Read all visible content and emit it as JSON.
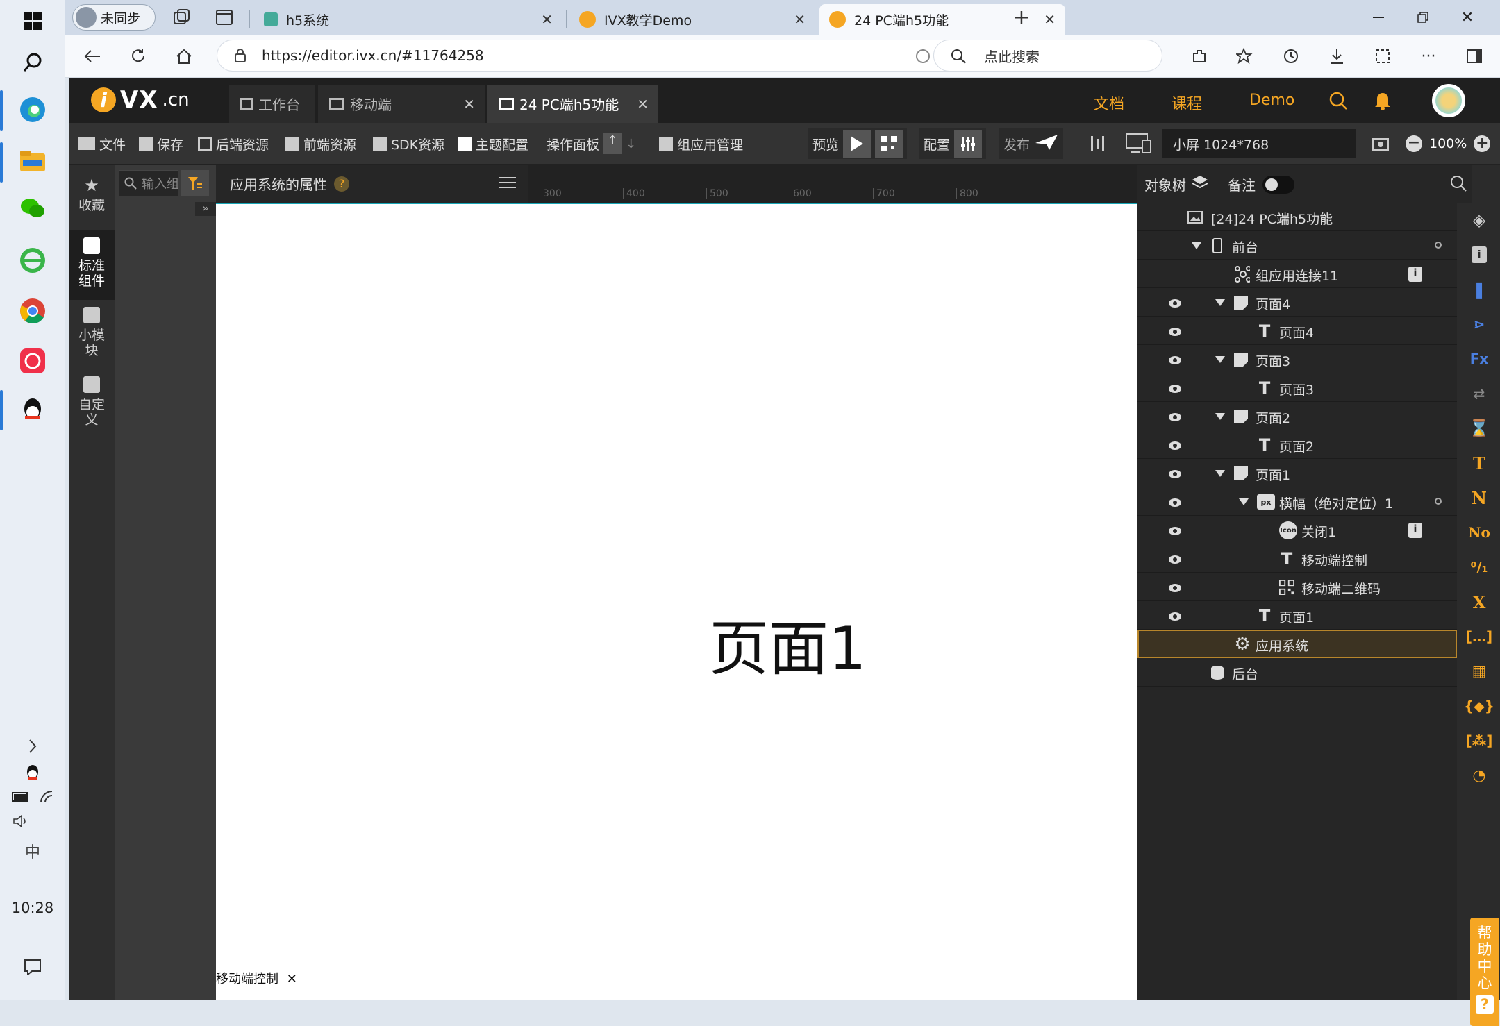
{
  "taskbar": {
    "clock": "10:28",
    "ime": "中"
  },
  "browser": {
    "profile_label": "未同步",
    "tabs": [
      {
        "label": "h5系统"
      },
      {
        "label": "IVX教学Demo"
      },
      {
        "label": "24 PC端h5功能"
      }
    ],
    "url": "https://editor.ivx.cn/#11764258",
    "search_placeholder": "点此搜索"
  },
  "editor": {
    "logo_text": "VX",
    "logo_suffix": ".cn",
    "tabs": [
      {
        "label": "工作台"
      },
      {
        "label": "移动端"
      },
      {
        "label": "24 PC端h5功能"
      }
    ],
    "header_links": [
      "文档",
      "课程",
      "Demo"
    ],
    "toolbar": {
      "file": "文件",
      "save": "保存",
      "backend": "后端资源",
      "frontend": "前端资源",
      "sdk": "SDK资源",
      "theme": "主题配置",
      "ops": "操作面板",
      "group": "组应用管理",
      "preview": "预览",
      "config": "配置",
      "publish": "发布",
      "screen": "小屏 1024*768",
      "zoom": "100%"
    },
    "left_categories": [
      {
        "label": "收藏"
      },
      {
        "label": "标准组件"
      },
      {
        "label": "小模块"
      },
      {
        "label": "自定义"
      }
    ],
    "component_search_placeholder": "输入组件名称",
    "property_title": "应用系统的属性",
    "ruler_ticks": [
      "300",
      "400",
      "500",
      "600",
      "700",
      "800"
    ],
    "canvas_title": "页面1",
    "mobile_control_label": "移动端控制",
    "tree_tabs": {
      "object_tree": "对象树",
      "note": "备注"
    },
    "tree": [
      {
        "label": "[24]24 PC端h5功能"
      },
      {
        "label": "前台"
      },
      {
        "label": "组应用连接11"
      },
      {
        "label": "页面4"
      },
      {
        "label": "页面4"
      },
      {
        "label": "页面3"
      },
      {
        "label": "页面3"
      },
      {
        "label": "页面2"
      },
      {
        "label": "页面2"
      },
      {
        "label": "页面1"
      },
      {
        "label": "横幅（绝对定位）1"
      },
      {
        "label": "关闭1"
      },
      {
        "label": "移动端控制"
      },
      {
        "label": "移动端二维码"
      },
      {
        "label": "页面1"
      },
      {
        "label": "应用系统"
      },
      {
        "label": "后台"
      }
    ],
    "help_center": "帮助中心"
  },
  "colors": {
    "accent": "#f5a623",
    "selection": "#b8862b",
    "canvas_border": "#18a6b6"
  }
}
